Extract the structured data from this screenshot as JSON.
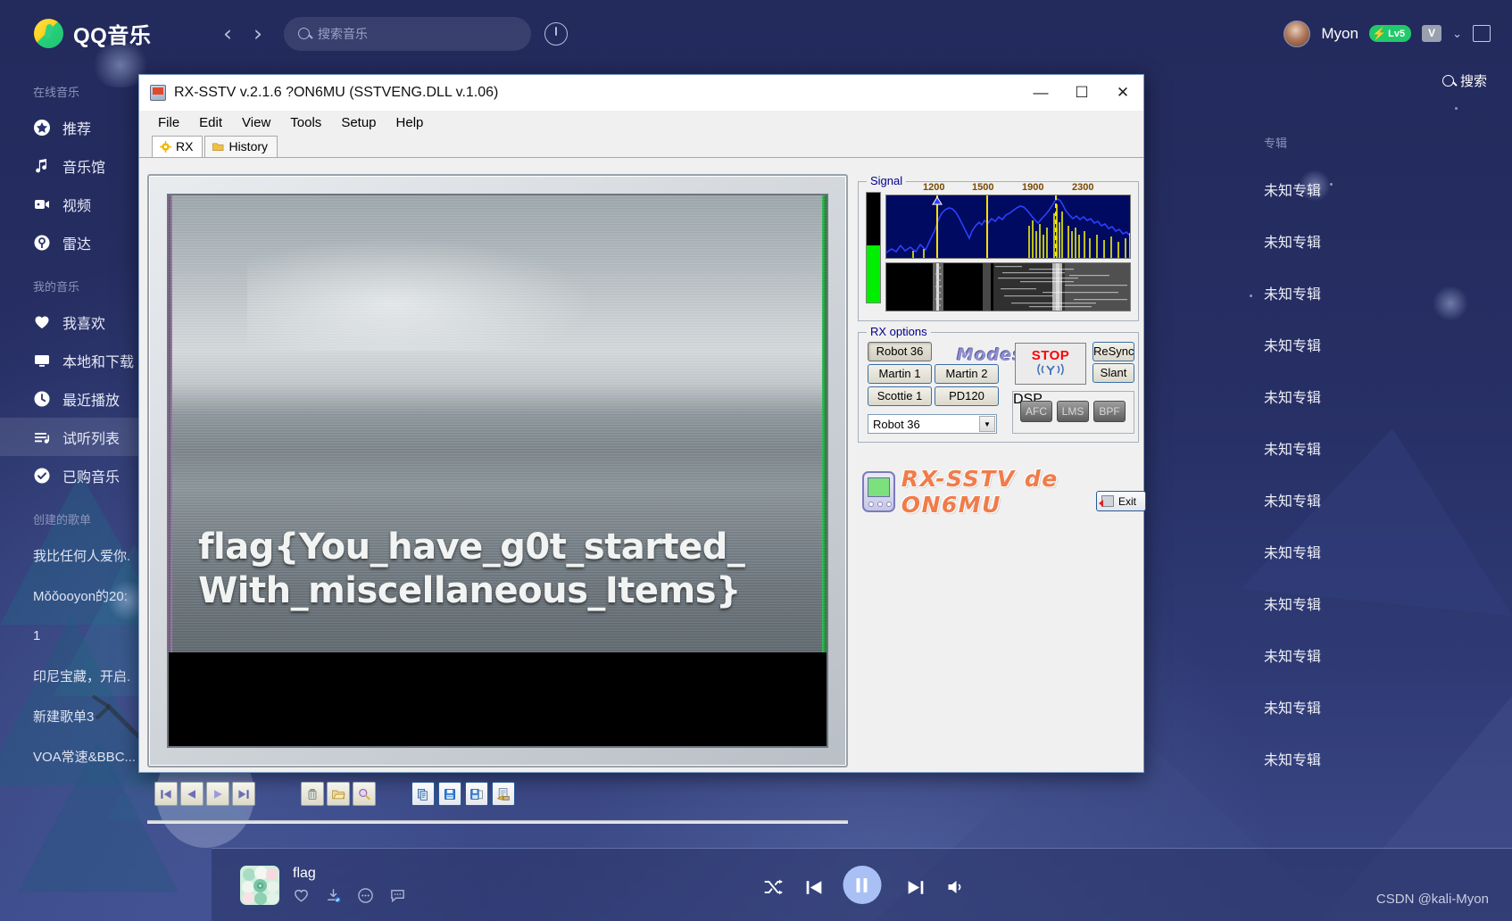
{
  "qq": {
    "brand": "QQ音乐",
    "nav": {
      "back": "‹",
      "forward": "›"
    },
    "search": {
      "placeholder": "搜索音乐",
      "icon": "search-icon"
    },
    "clock_icon": "history-clock-icon",
    "user": {
      "name": "Myon",
      "level": "Lv5",
      "vip": "V",
      "chevron": "⌄"
    },
    "secondary_search": "搜索",
    "sidebar": {
      "group_online": "在线音乐",
      "group_mine": "我的音乐",
      "group_created": "创建的歌单",
      "online_items": [
        {
          "label": "推荐",
          "icon": "star-icon"
        },
        {
          "label": "音乐馆",
          "icon": "music-note-icon"
        },
        {
          "label": "视频",
          "icon": "video-icon"
        },
        {
          "label": "雷达",
          "icon": "radar-icon"
        }
      ],
      "mine_items": [
        {
          "label": "我喜欢",
          "icon": "heart-icon"
        },
        {
          "label": "本地和下载",
          "icon": "monitor-icon"
        },
        {
          "label": "最近播放",
          "icon": "clock-icon"
        },
        {
          "label": "试听列表",
          "icon": "playlist-icon",
          "active": true
        },
        {
          "label": "已购音乐",
          "icon": "check-circle-icon"
        }
      ],
      "playlists": [
        "我比任何人爱你.",
        "Mǒǒooyon的20:",
        "1",
        "印尼宝藏，开启.",
        "新建歌单3",
        "VOA常速&BBC..."
      ]
    },
    "albums": {
      "header": "专辑",
      "rows": [
        "未知专辑",
        "未知专辑",
        "未知专辑",
        "未知专辑",
        "未知专辑",
        "未知专辑",
        "未知专辑",
        "未知专辑",
        "未知专辑",
        "未知专辑",
        "未知专辑",
        "未知专辑"
      ]
    },
    "player": {
      "track": "flag",
      "like_icon": "heart-outline-icon",
      "download_icon": "download-done-icon",
      "more_icon": "more-dots-icon",
      "comment_icon": "comment-icon",
      "shuffle_icon": "shuffle-icon",
      "prev_icon": "previous-icon",
      "play_state_icon": "pause-icon",
      "next_icon": "next-icon",
      "volume_icon": "volume-icon"
    },
    "watermark": "CSDN @kali-Myon"
  },
  "sstv": {
    "title": "RX-SSTV v.2.1.6 ?ON6MU (SSTVENG.DLL v.1.06)",
    "window_buttons": {
      "minimize": "—",
      "maximize": "☐",
      "close": "✕"
    },
    "menu": [
      "File",
      "Edit",
      "View",
      "Tools",
      "Setup",
      "Help"
    ],
    "tabs": [
      {
        "label": "RX",
        "icon": "gear-icon",
        "active": true
      },
      {
        "label": "History",
        "icon": "folder-icon",
        "active": false
      }
    ],
    "image_text_line1": "flag{You_have_g0t_started_",
    "image_text_line2": "With_miscellaneous_Items}",
    "toolbar": {
      "first": "first-frame-button",
      "prev": "previous-frame-button",
      "play": "play-button",
      "last": "last-frame-button",
      "trash": "delete-button",
      "open": "open-folder-button",
      "zoom": "zoom-button",
      "copy": "copy-button",
      "save": "save-button",
      "save_as": "save-as-button",
      "export": "export-button"
    },
    "signal": {
      "legend": "Signal",
      "ticks": [
        "1200",
        "1500",
        "1900",
        "2300"
      ],
      "meter_level": 52
    },
    "rx_options": {
      "legend": "RX options",
      "modes_logo": "Modes",
      "mode_buttons": [
        {
          "label": "Robot 36",
          "selected": true
        },
        {
          "label": "Martin 1",
          "selected": false
        },
        {
          "label": "Martin 2",
          "selected": false
        },
        {
          "label": "Scottie 1",
          "selected": false
        },
        {
          "label": "PD120",
          "selected": false
        }
      ],
      "mode_select_value": "Robot 36",
      "mode_select_arrow": "▼",
      "stop_label": "STOP",
      "stop_icon": "antenna-icon",
      "resync_label": "ReSync",
      "slant_label": "Slant",
      "dsp_legend": "DSP",
      "dsp_buttons": [
        "AFC",
        "LMS",
        "BPF"
      ]
    },
    "brand_text": "RX-SSTV de ON6MU",
    "exit_label": "Exit"
  },
  "colors": {
    "qq_bg": "#262e63",
    "accent_green": "#22c96b",
    "stop_red": "#ff0000",
    "signal_bg": "#000a60",
    "meter_green": "#00ef00",
    "group_label": "#00008b"
  }
}
